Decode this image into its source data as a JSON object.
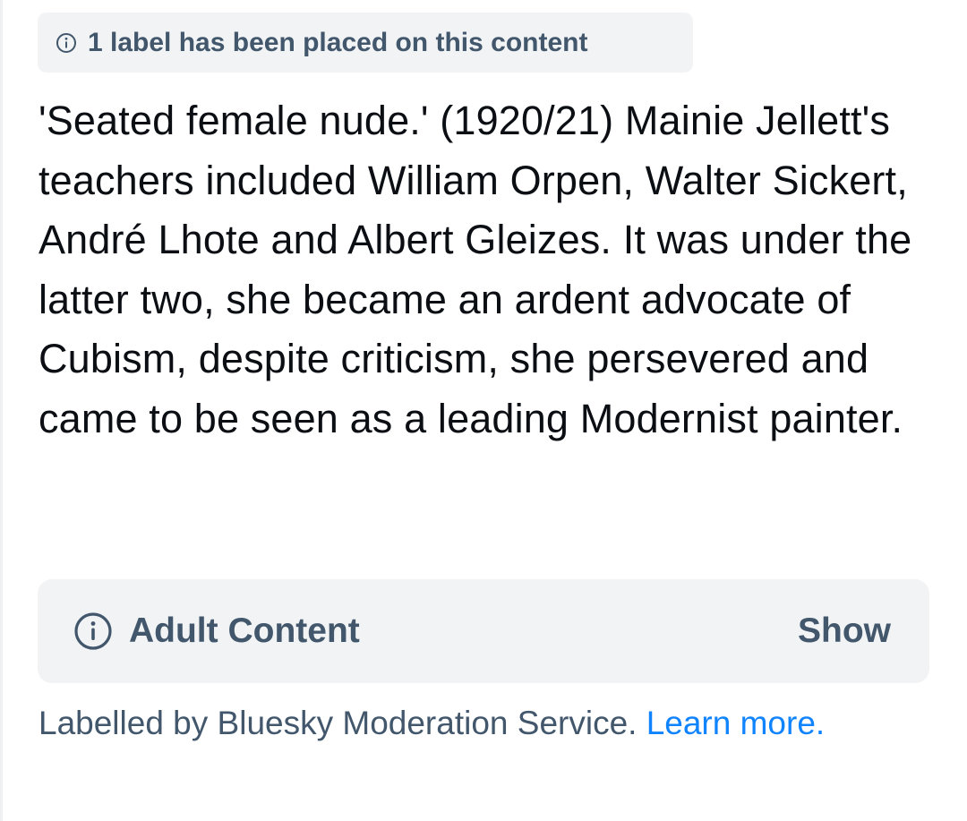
{
  "label_notice": {
    "icon": "info-icon",
    "text": "1 label has been placed on this content"
  },
  "post": {
    "text": "'Seated female nude.' (1920/21) Mainie Jellett's teachers included William Orpen, Walter Sickert, André Lhote and Albert Gleizes. It was under the latter two, she became an ardent advocate of Cubism, despite criticism, she persevered and came to be seen as a leading Modernist painter."
  },
  "content_warning": {
    "icon": "info-icon",
    "title": "Adult Content",
    "show_label": "Show"
  },
  "footer": {
    "labelled_by": "Labelled by Bluesky Moderation Service.",
    "learn_more": "Learn more."
  },
  "colors": {
    "muted_text": "#42576c",
    "chip_background": "#f1f3f5",
    "link": "#1083fe",
    "body_text": "#0b0f14"
  }
}
